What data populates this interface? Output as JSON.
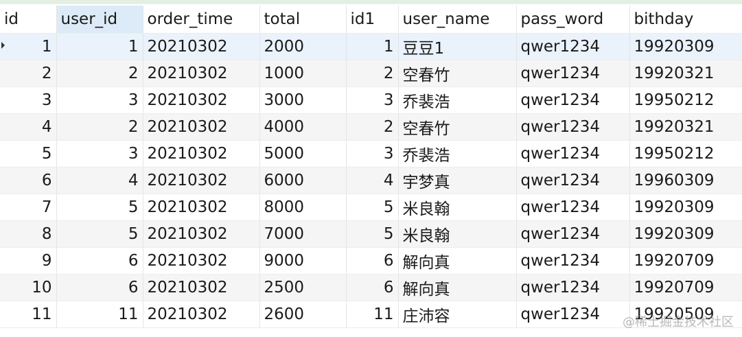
{
  "columns": [
    "id",
    "user_id",
    "order_time",
    "total",
    "id1",
    "user_name",
    "pass_word",
    "bithday"
  ],
  "rows": [
    [
      "1",
      "1",
      "20210302",
      "2000",
      "1",
      "豆豆1",
      "qwer1234",
      "19920309"
    ],
    [
      "2",
      "2",
      "20210302",
      "1000",
      "2",
      "空春竹",
      "qwer1234",
      "19920321"
    ],
    [
      "3",
      "3",
      "20210302",
      "3000",
      "3",
      "乔裴浩",
      "qwer1234",
      "19950212"
    ],
    [
      "4",
      "2",
      "20210302",
      "4000",
      "2",
      "空春竹",
      "qwer1234",
      "19920321"
    ],
    [
      "5",
      "3",
      "20210302",
      "5000",
      "3",
      "乔裴浩",
      "qwer1234",
      "19950212"
    ],
    [
      "6",
      "4",
      "20210302",
      "6000",
      "4",
      "宇梦真",
      "qwer1234",
      "19960309"
    ],
    [
      "7",
      "5",
      "20210302",
      "8000",
      "5",
      "米良翰",
      "qwer1234",
      "19920309"
    ],
    [
      "8",
      "5",
      "20210302",
      "7000",
      "5",
      "米良翰",
      "qwer1234",
      "19920309"
    ],
    [
      "9",
      "6",
      "20210302",
      "9000",
      "6",
      "解向真",
      "qwer1234",
      "19920709"
    ],
    [
      "10",
      "6",
      "20210302",
      "2500",
      "6",
      "解向真",
      "qwer1234",
      "19920709"
    ],
    [
      "11",
      "11",
      "20210302",
      "2600",
      "11",
      "庄沛容",
      "qwer1234",
      "19920509"
    ]
  ],
  "watermark": "@稀土掘金技术社区",
  "colors": {
    "header_sorted": "#dcebf7",
    "selected_row": "#eaf2fb",
    "alt_row": "#f5f5f5"
  },
  "icons": {
    "current_row": "row-pointer-icon"
  }
}
